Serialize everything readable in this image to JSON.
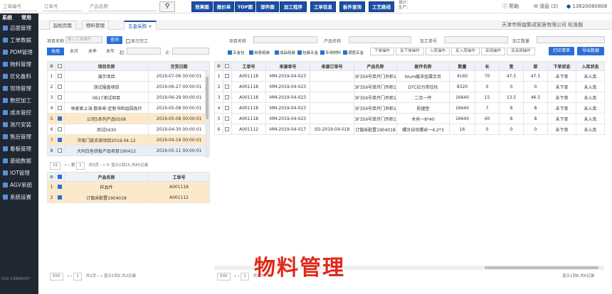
{
  "topbar": {
    "field_worknum": "工单编号",
    "field_ordernum": "订单号",
    "field_product": "产品名称",
    "search_icon": "search-icon",
    "menu": [
      "效果图",
      "报价单",
      "TOP图",
      "部件图",
      "加工程序",
      "工单信息",
      "板件查询",
      "工艺路线"
    ],
    "designer_label": "设计：",
    "produce_label": "生产：",
    "help": "帮助",
    "messages": "消息 (2)",
    "phone": "13820080808"
  },
  "sidebar": {
    "head_system": "系统",
    "head_common": "常用",
    "items": [
      "店面管理",
      "工单数据",
      "PDM管理",
      "物料管理",
      "优化备料",
      "现场管理",
      "数控加工",
      "成本管控",
      "测尺安装",
      "售后管理",
      "看板管理",
      "基础数据",
      "IOT管理",
      "AGV系统",
      "系统设置"
    ],
    "footer_phone": "022-23868097"
  },
  "tabs": [
    "起始页面",
    "物料管理",
    "五金采购"
  ],
  "company": "天津市辉煌集成家居有限公司   标准版",
  "left_filter": {
    "proj_label": "项目名称",
    "proj_placeholder": "输入工单编号",
    "query_btn": "查询",
    "show_done": "显示完工",
    "date_tabs": [
      "本周",
      "本月",
      "本季",
      "本年"
    ],
    "start_label": "起:",
    "end_label": "止:"
  },
  "left_table": {
    "headers": [
      "",
      "",
      "项目名称",
      "交货日期"
    ],
    "rows": [
      {
        "n": "1",
        "name": "演示项目",
        "date": "2019-07-06 00:00:01",
        "sel": false,
        "checked": false
      },
      {
        "n": "2",
        "name": "测试报盘项目",
        "date": "2019-06-27 00:00:01",
        "sel": false,
        "checked": false
      },
      {
        "n": "3",
        "name": "0617测试项目",
        "date": "2019-06-29 00:00:01",
        "sel": false,
        "checked": false
      },
      {
        "n": "4",
        "name": "林家家上海·数寿寿·定制书柜组因改尺",
        "date": "2019-05-08 00:00:01",
        "sel": false,
        "checked": false
      },
      {
        "n": "5",
        "name": "公司5系列产品0508",
        "date": "2019-05-08 00:00:01",
        "sel": true,
        "checked": true
      },
      {
        "n": "6",
        "name": "测试0430",
        "date": "2019-04-30 00:00:01",
        "sel": false,
        "checked": false
      },
      {
        "n": "7",
        "name": "济南门款衣架项目2019.04.12",
        "date": "2019-04-19 00:00:01",
        "sel": true,
        "checked": true
      },
      {
        "n": "8",
        "name": "大同白色铁板产品项目190412",
        "date": "2019-05-11 00:00:01",
        "sel": false,
        "checked": false,
        "hl": true
      }
    ],
    "pager": {
      "size": "15",
      "page_label": "第",
      "page": "1",
      "total_pages": "共5页",
      "summary": "显示1到15,共65记录"
    }
  },
  "left_sub_table": {
    "headers": [
      "",
      "",
      "产品名称",
      "工单号"
    ],
    "rows": [
      {
        "n": "1",
        "name": "样品件",
        "work": "A001118"
      },
      {
        "n": "2",
        "name": "订做床配置1904018",
        "work": "A001112"
      }
    ],
    "pager": {
      "size": "500",
      "page": "1",
      "total_pages": "共1页",
      "summary": "显示1到2,共2记录"
    }
  },
  "right_filter": {
    "project_label": "项目名称",
    "product_label": "产品名称",
    "work_label": "加工单号",
    "qty_label": "加工数量",
    "checks": [
      {
        "label": "五金包",
        "on": true
      },
      {
        "label": "自身组装",
        "on": true
      },
      {
        "label": "成品组装",
        "on": true
      },
      {
        "label": "包装五金",
        "on": true
      },
      {
        "label": "专用材料",
        "on": true
      },
      {
        "label": "调值五金",
        "on": true
      }
    ],
    "buttons": [
      "下单操作",
      "反下单操作",
      "入库操作",
      "反入库操作",
      "采用操作",
      "反采用操作"
    ],
    "print_btn": "打印清单",
    "export_btn": "导出数据"
  },
  "right_table": {
    "headers": [
      "",
      "",
      "工单号",
      "来源单号",
      "来源订单号",
      "产品名称",
      "板件名称",
      "数量",
      "长",
      "宽",
      "厚",
      "下单状态",
      "入库状态"
    ],
    "rows": [
      {
        "n": "1",
        "work": "A001118",
        "src": "MM-2019-04-023",
        "srco": "",
        "product": "3F359号单开门吊柜1",
        "part": "blum缓冲金属合页",
        "qty": "4160",
        "l": "70",
        "w": "47.5",
        "t": "47.5",
        "order": "未下单",
        "stock": "未入库"
      },
      {
        "n": "2",
        "work": "A001118",
        "src": "MM-2019-04-023",
        "srco": "",
        "product": "3F359号单开门吊柜1",
        "part": "DTC拉力带铰托",
        "qty": "8320",
        "l": "0",
        "w": "0",
        "t": "0",
        "order": "未下单",
        "stock": "未入库"
      },
      {
        "n": "3",
        "work": "A001118",
        "src": "MM-2019-04-023",
        "srco": "",
        "product": "3F359号单开门吊柜1",
        "part": "二合一件",
        "qty": "16640",
        "l": "15",
        "w": "13.5",
        "t": "46.5",
        "order": "未下单",
        "stock": "未入库"
      },
      {
        "n": "4",
        "work": "A001118",
        "src": "MM-2019-04-023",
        "srco": "",
        "product": "3F359号单开门吊柜1",
        "part": "防撞垫",
        "qty": "16640",
        "l": "7",
        "w": "8",
        "t": "8",
        "order": "未下单",
        "stock": "未入库"
      },
      {
        "n": "5",
        "work": "A001118",
        "src": "MM-2019-04-023",
        "srco": "",
        "product": "3F359号单开门吊柜1",
        "part": "木肖一8*40",
        "qty": "16640",
        "l": "40",
        "w": "8",
        "t": "8",
        "order": "未下单",
        "stock": "未入库"
      },
      {
        "n": "6",
        "work": "A001112",
        "src": "MM-2019-04-017",
        "srco": "SO-2019-04-018",
        "product": "订做床配置1904018",
        "part": "螺牙自攻螺丝一4.2*3",
        "qty": "16",
        "l": "0",
        "w": "0",
        "t": "0",
        "order": "未下单",
        "stock": "未入库"
      }
    ],
    "pager": {
      "size": "500",
      "page": "1",
      "total_pages": "共1页",
      "summary": "显示1到6,共6记录"
    }
  },
  "caption": "物料管理",
  "colors": {
    "accent": "#1a4fa3",
    "sidebar": "#1f2733",
    "selected_row": "#fde9c8",
    "caption": "#e02a1a"
  }
}
